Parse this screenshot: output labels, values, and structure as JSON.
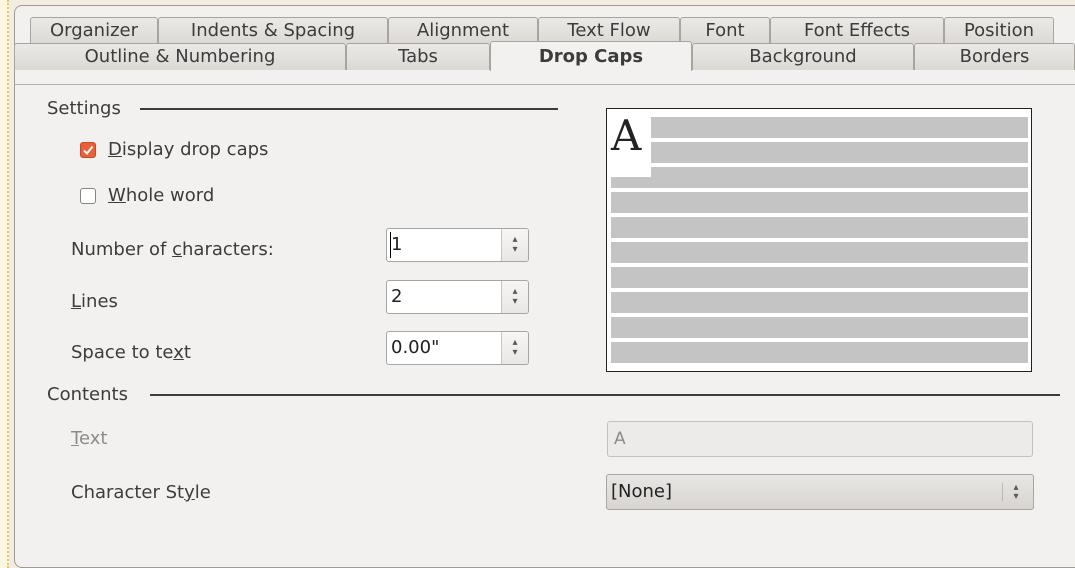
{
  "tabs_row1": [
    "Organizer",
    "Indents & Spacing",
    "Alignment",
    "Text Flow",
    "Font",
    "Font Effects",
    "Position"
  ],
  "tabs_row2": [
    "Outline & Numbering",
    "Tabs",
    "Drop Caps",
    "Background",
    "Borders"
  ],
  "active_tab": "Drop Caps",
  "settings": {
    "group_label": "Settings",
    "display_drop_caps": {
      "label_pre": "",
      "mnemonic": "D",
      "label_post": "isplay drop caps",
      "checked": true
    },
    "whole_word": {
      "label_pre": "",
      "mnemonic": "W",
      "label_post": "hole word",
      "checked": false
    },
    "number_of_characters": {
      "label_pre": "Number of ",
      "mnemonic": "c",
      "label_post": "haracters:",
      "value": "1"
    },
    "lines": {
      "label_pre": "",
      "mnemonic": "L",
      "label_post": "ines",
      "value": "2"
    },
    "space_to_text": {
      "label_pre": "Space to te",
      "mnemonic": "x",
      "label_post": "t",
      "value": "0.00\""
    }
  },
  "preview": {
    "drop_cap_letter": "A"
  },
  "contents": {
    "group_label": "Contents",
    "text": {
      "label_pre": "",
      "mnemonic": "T",
      "label_post": "ext",
      "value": "A",
      "disabled": true
    },
    "character_style": {
      "label_pre": "Character St",
      "mnemonic": "y",
      "label_post": "le",
      "value": "[None]"
    }
  },
  "colors": {
    "accent": "#e8603a",
    "dialog_bg": "#f2f1f0"
  }
}
